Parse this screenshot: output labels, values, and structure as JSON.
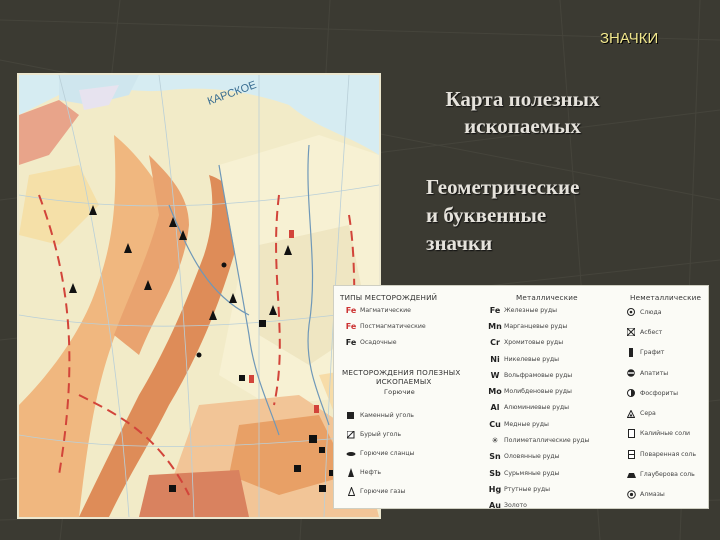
{
  "slide": {
    "corner_label": "ЗНАЧКИ",
    "title": "Карта полезных ископаемых",
    "subtitle_lines": [
      "Геометрические",
      "и буквенные",
      "значки"
    ]
  },
  "map": {
    "labels": [
      "КАРСКОЕ"
    ]
  },
  "legend": {
    "types_header": "ТИПЫ МЕСТОРОЖДЕНИЙ",
    "types": [
      {
        "symbol": "Fe",
        "label": "Магматические"
      },
      {
        "symbol": "Fe",
        "label": "Постмагматические"
      },
      {
        "symbol": "Fe",
        "label": "Осадочные"
      }
    ],
    "deposits_header_line1": "МЕСТОРОЖДЕНИЯ ПОЛЕЗНЫХ",
    "deposits_header_line2": "ИСКОПАЕМЫХ",
    "fuel_header": "Горючие",
    "fuel": [
      {
        "icon": "square",
        "label": "Каменный уголь"
      },
      {
        "icon": "square-hatched",
        "label": "Бурый уголь"
      },
      {
        "icon": "leaf",
        "label": "Горючие сланцы"
      },
      {
        "icon": "drop",
        "label": "Нефть"
      },
      {
        "icon": "triangle-outline",
        "label": "Горючие газы"
      }
    ],
    "metal_header": "Металлические",
    "metals": [
      {
        "symbol": "Fe",
        "label": "Железные руды"
      },
      {
        "symbol": "Mn",
        "label": "Марганцевые руды"
      },
      {
        "symbol": "Cr",
        "label": "Хромитовые руды"
      },
      {
        "symbol": "Ni",
        "label": "Никелевые руды"
      },
      {
        "symbol": "W",
        "label": "Вольфрамовые руды"
      },
      {
        "symbol": "Mo",
        "label": "Молибденовые руды"
      },
      {
        "symbol": "Al",
        "label": "Алюминиевые руды"
      },
      {
        "symbol": "Cu",
        "label": "Медные руды"
      },
      {
        "symbol": "✳",
        "label": "Полиметаллические руды"
      },
      {
        "symbol": "Sn",
        "label": "Оловянные руды"
      },
      {
        "symbol": "Sb",
        "label": "Сурьмяные руды"
      },
      {
        "symbol": "Hg",
        "label": "Ртутные руды"
      },
      {
        "symbol": "Au",
        "label": "Золото"
      }
    ],
    "nonmetal_header": "Неметаллические",
    "nonmetals": [
      {
        "icon": "circle-dot",
        "label": "Слюда"
      },
      {
        "icon": "cross",
        "label": "Асбест"
      },
      {
        "icon": "bar",
        "label": "Графит"
      },
      {
        "icon": "circle-bar",
        "label": "Апатиты"
      },
      {
        "icon": "circle-half",
        "label": "Фосфориты"
      },
      {
        "icon": "triangle",
        "label": "Сера"
      },
      {
        "icon": "rect-outline",
        "label": "Калийные соли"
      },
      {
        "icon": "rect-outline",
        "label": "Поваренная соль"
      },
      {
        "icon": "mound",
        "label": "Глауберова соль"
      },
      {
        "icon": "star-circle",
        "label": "Алмазы"
      }
    ]
  },
  "colors": {
    "background": "#3b3a32",
    "text": "#e6e3dc",
    "accent": "#f0e68c",
    "metal_symbol": "#c33"
  }
}
